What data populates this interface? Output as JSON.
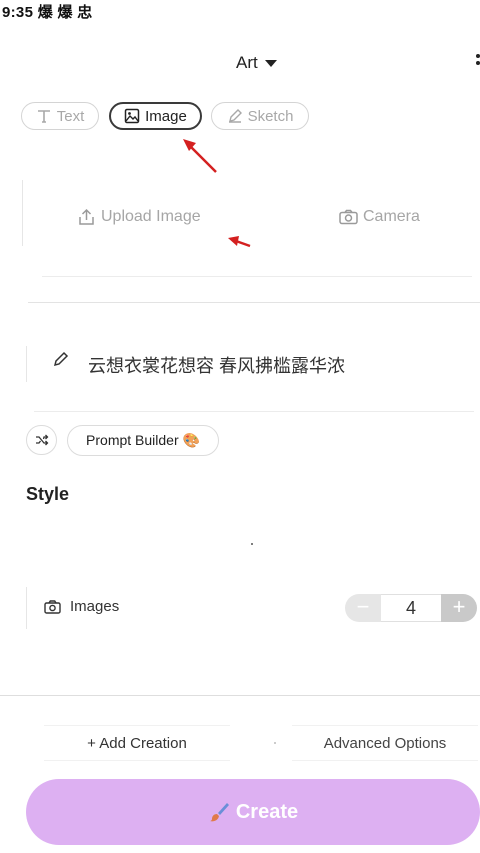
{
  "status_bar": {
    "time": "9:35",
    "notification_text": "爆 爆 忠"
  },
  "header": {
    "mode_label": "Art"
  },
  "input_tabs": [
    {
      "label": "Text",
      "icon": "text-icon",
      "active": false
    },
    {
      "label": "Image",
      "icon": "image-icon",
      "active": true
    },
    {
      "label": "Sketch",
      "icon": "pencil-icon",
      "active": false
    }
  ],
  "upload": {
    "upload_label": "Upload Image",
    "camera_label": "Camera"
  },
  "prompt": {
    "text": "云想衣裳花想容 春风拂槛露华浓"
  },
  "builder": {
    "label": "Prompt Builder 🎨"
  },
  "style": {
    "heading": "Style"
  },
  "images": {
    "label": "Images",
    "count": "4",
    "minus": "−",
    "plus": "+"
  },
  "actions": {
    "add_creation": "+ Add Creation",
    "advanced_options": "Advanced Options",
    "create": "Create"
  },
  "colors": {
    "create_button": "#ddb0f2",
    "annotation_arrow": "#d42020"
  }
}
